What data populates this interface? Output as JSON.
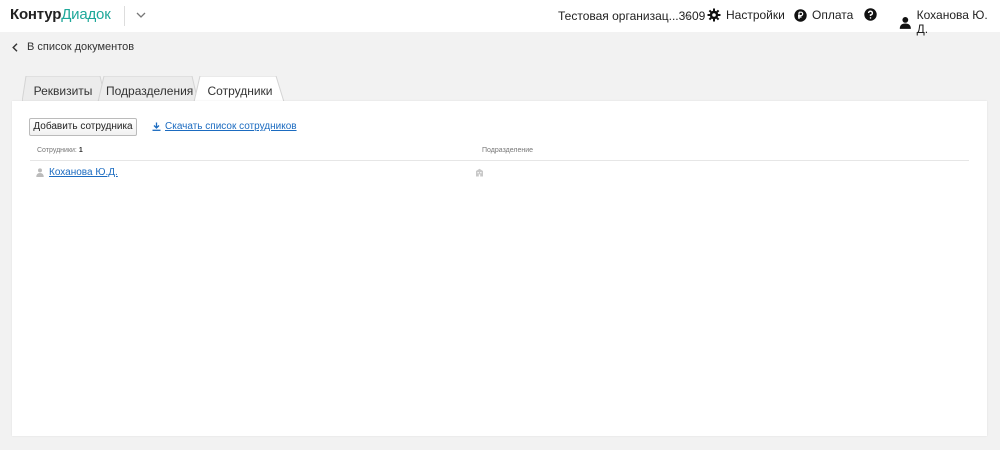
{
  "header": {
    "logo_brand": "Контур",
    "logo_product": "Диадок",
    "organization": "Тестовая организац...3609",
    "settings_label": "Настройки",
    "payment_label": "Оплата",
    "user_name": "Коханова Ю. Д."
  },
  "nav": {
    "back_label": "В список документов"
  },
  "tabs": [
    {
      "label": "Реквизиты",
      "active": false
    },
    {
      "label": "Подразделения",
      "active": false
    },
    {
      "label": "Сотрудники",
      "active": true
    }
  ],
  "toolbar": {
    "add_employee_label": "Добавить сотрудника",
    "download_label": "Скачать список сотрудников"
  },
  "table": {
    "employees_header": "Сотрудники:",
    "employees_count": "1",
    "department_header": "Подразделение",
    "rows": [
      {
        "name": "Коханова Ю.Д.",
        "department": ""
      }
    ]
  },
  "colors": {
    "accent": "#1fa89a",
    "link": "#1b6bc0"
  }
}
